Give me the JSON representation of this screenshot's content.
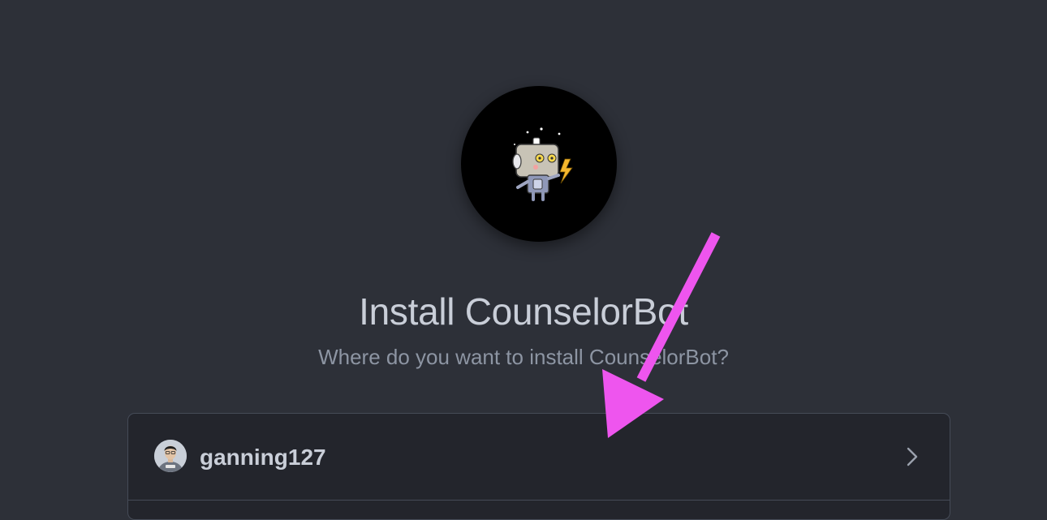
{
  "app": {
    "name": "CounselorBot",
    "avatar_icon": "robot-icon"
  },
  "header": {
    "title": "Install CounselorBot",
    "subtitle": "Where do you want to install CounselorBot?"
  },
  "accounts": [
    {
      "name": "ganning127",
      "avatar_icon": "user-avatar"
    }
  ],
  "annotation": {
    "type": "arrow",
    "color": "#ee55ee"
  },
  "colors": {
    "background": "#2d3038",
    "panel": "#23252c",
    "border": "#454b57",
    "text_primary": "#c9ced8",
    "text_secondary": "#8d95a3"
  }
}
